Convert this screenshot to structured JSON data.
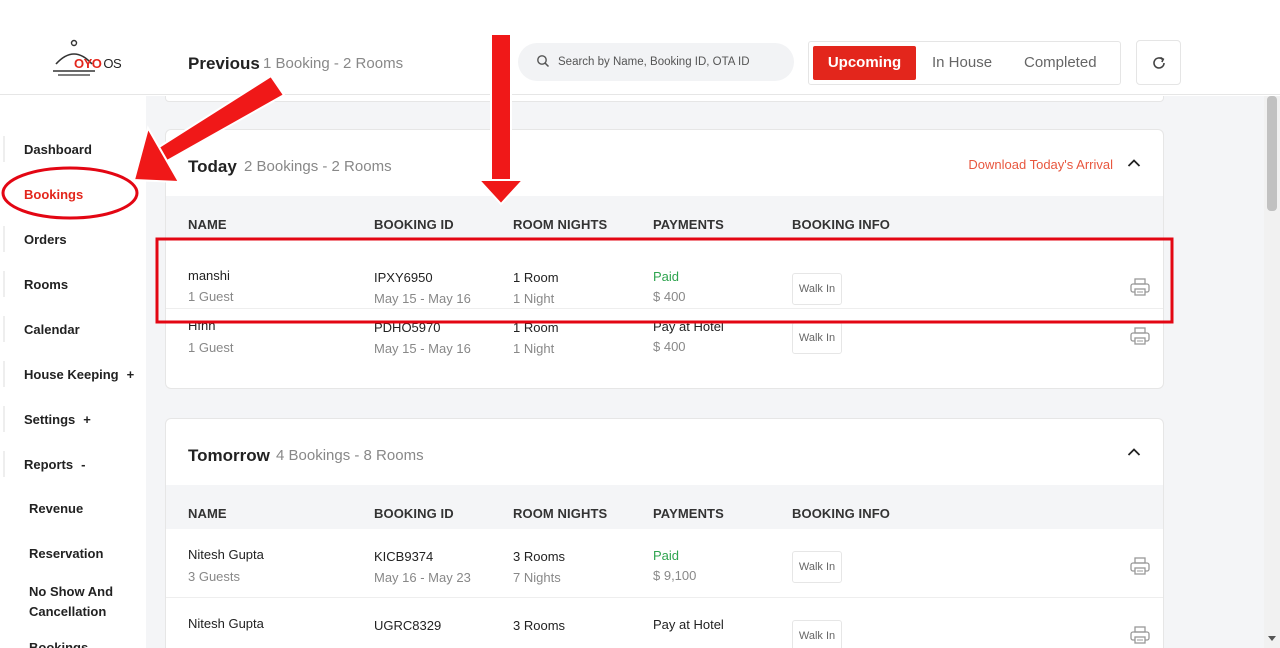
{
  "app": {
    "logo_brand": "OYO",
    "logo_suffix": "OS"
  },
  "header": {
    "title": "Previous",
    "subtitle": "1 Booking - 2 Rooms",
    "search_placeholder": "Search by Name, Booking ID, OTA ID",
    "tabs": [
      "Upcoming",
      "In House",
      "Completed"
    ]
  },
  "sidebar": {
    "items": [
      {
        "label": "Dashboard"
      },
      {
        "label": "Bookings"
      },
      {
        "label": "Orders"
      },
      {
        "label": "Rooms"
      },
      {
        "label": "Calendar"
      },
      {
        "label": "House Keeping",
        "expander": "+"
      },
      {
        "label": "Settings",
        "expander": "+"
      },
      {
        "label": "Reports",
        "expander": "-"
      }
    ],
    "sub_items": [
      {
        "label": "Revenue"
      },
      {
        "label": "Reservation"
      },
      {
        "label": "No Show And Cancellation"
      },
      {
        "label": "Bookings"
      }
    ]
  },
  "columns": [
    "NAME",
    "BOOKING ID",
    "ROOM NIGHTS",
    "PAYMENTS",
    "BOOKING INFO"
  ],
  "today": {
    "title": "Today",
    "subtitle": "2 Bookings - 2 Rooms",
    "download_label": "Download Today's Arrival",
    "rows": [
      {
        "name": "manshi",
        "guests": "1 Guest",
        "booking_id": "IPXY6950",
        "dates": "May 15 - May 16",
        "rooms": "1 Room",
        "nights": "1 Night",
        "payment_status": "Paid",
        "amount": "$ 400",
        "info": "Walk In"
      },
      {
        "name": "Hfhh",
        "guests": "1 Guest",
        "booking_id": "PDHO5970",
        "dates": "May 15 - May 16",
        "rooms": "1 Room",
        "nights": "1 Night",
        "payment_status": "Pay at Hotel",
        "amount": "$ 400",
        "info": "Walk In"
      }
    ]
  },
  "tomorrow": {
    "title": "Tomorrow",
    "subtitle": "4 Bookings - 8 Rooms",
    "rows": [
      {
        "name": "Nitesh Gupta",
        "guests": "3 Guests",
        "booking_id": "KICB9374",
        "dates": "May 16 - May 23",
        "rooms": "3 Rooms",
        "nights": "7 Nights",
        "payment_status": "Paid",
        "amount": "$ 9,100",
        "info": "Walk In"
      },
      {
        "name": "Nitesh Gupta",
        "guests": "",
        "booking_id": "UGRC8329",
        "dates": "",
        "rooms": "3 Rooms",
        "nights": "",
        "payment_status": "Pay at Hotel",
        "amount": "",
        "info": "Walk In"
      }
    ]
  },
  "colors": {
    "accent": "#e3261c",
    "paid": "#2ea44f",
    "link": "#e8573f"
  },
  "icons": [
    "search-icon",
    "refresh-icon",
    "chevron-up-icon",
    "printer-icon",
    "cloche-icon"
  ]
}
